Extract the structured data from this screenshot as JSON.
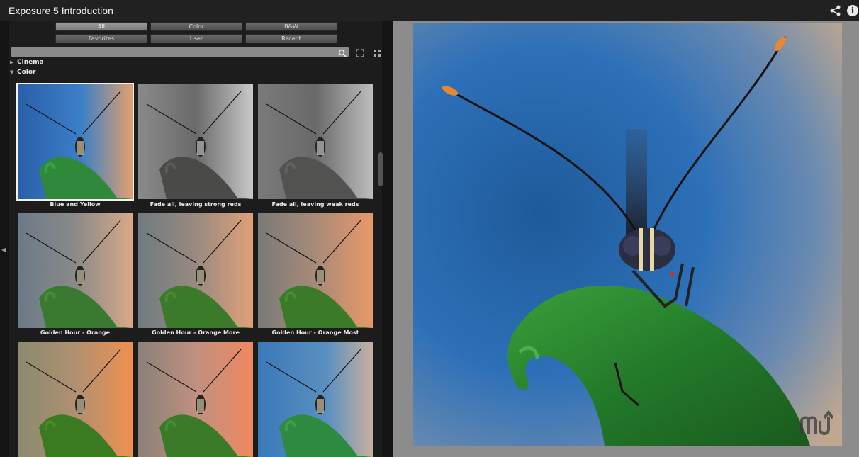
{
  "window": {
    "title": "Exposure 5 Introduction"
  },
  "header_icons": {
    "share": "share-icon",
    "info": "info-icon",
    "info_glyph": "i"
  },
  "filters": {
    "all": "All",
    "color": "Color",
    "bw": "B&W",
    "favorites": "Favorites",
    "user": "User",
    "recent": "Recent"
  },
  "categories": {
    "cinema": "Cinema",
    "color": "Color"
  },
  "presets": [
    {
      "label": "Blue and Yellow"
    },
    {
      "label": "Fade all, leaving strong reds"
    },
    {
      "label": "Fade all, leaving weak reds"
    },
    {
      "label": "Golden Hour - Orange"
    },
    {
      "label": "Golden Hour - Orange More"
    },
    {
      "label": "Golden Hour - Orange Most"
    },
    {
      "label": ""
    },
    {
      "label": ""
    },
    {
      "label": ""
    }
  ],
  "selected_preset": "Blue and Yellow",
  "colors": {
    "accent_selected": "#f2f2f2",
    "panel_bg": "#1c1c1c",
    "preview_bg": "#8c8c8c"
  }
}
